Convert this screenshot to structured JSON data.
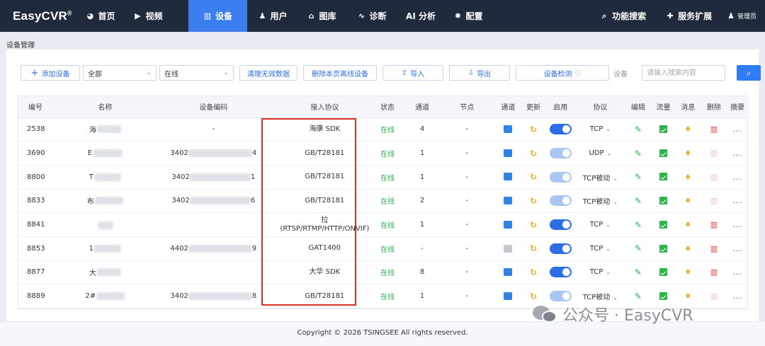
{
  "brand": {
    "name": "EasyCVR",
    "mark": "®"
  },
  "nav": {
    "items": [
      {
        "label": "首页",
        "icon": "dashboard-icon"
      },
      {
        "label": "视频",
        "icon": "play-icon"
      },
      {
        "label": "设备",
        "icon": "device-icon",
        "active": true
      },
      {
        "label": "用户",
        "icon": "user-icon"
      },
      {
        "label": "图库",
        "icon": "gallery-icon"
      },
      {
        "label": "诊断",
        "icon": "pulse-icon"
      },
      {
        "label": "AI 分析",
        "icon": ""
      },
      {
        "label": "配置",
        "icon": "gear-icon"
      }
    ],
    "right": [
      {
        "label": "功能搜索",
        "icon": "search-icon"
      },
      {
        "label": "服务扩展",
        "icon": "puzzle-icon"
      }
    ],
    "user": "管理员"
  },
  "page": {
    "title": "设备管理"
  },
  "toolbar": {
    "add_label": "添加设备",
    "filter_all": "全部",
    "filter_status": "在线",
    "clean_label": "清理无效数据",
    "delete_offline_label": "删除本页离线设备",
    "import_label": "导入",
    "export_label": "导出",
    "check_label": "设备检测",
    "search_label": "设备",
    "search_placeholder": "请输入搜索内容"
  },
  "table": {
    "headers": [
      "编号",
      "名称",
      "设备编码",
      "接入协议",
      "状态",
      "通道",
      "节点",
      "通道",
      "更新",
      "启用",
      "协议",
      "编辑",
      "流量",
      "消息",
      "删除",
      "摘要"
    ],
    "rows": [
      {
        "id": "2538",
        "name_prefix": "海",
        "code_prefix": "-",
        "code_suffix": "",
        "protocol": "海康 SDK",
        "status": "在线",
        "channels": "4",
        "node": "-",
        "enabled": true,
        "stream": "TCP",
        "folder_grey": false,
        "trash_light": false
      },
      {
        "id": "3690",
        "name_prefix": "E",
        "code_prefix": "3402",
        "code_suffix": "4",
        "protocol": "GB/T28181",
        "status": "在线",
        "channels": "1",
        "node": "-",
        "enabled": false,
        "stream": "UDP",
        "folder_grey": false,
        "trash_light": true
      },
      {
        "id": "8800",
        "name_prefix": "T",
        "code_prefix": "3402",
        "code_suffix": "1",
        "protocol": "GB/T28181",
        "status": "在线",
        "channels": "1",
        "node": "-",
        "enabled": false,
        "stream": "TCP被动",
        "folder_grey": false,
        "trash_light": true
      },
      {
        "id": "8833",
        "name_prefix": "布",
        "code_prefix": "3402",
        "code_suffix": "6",
        "protocol": "GB/T28181",
        "status": "在线",
        "channels": "2",
        "node": "-",
        "enabled": false,
        "stream": "TCP被动",
        "folder_grey": false,
        "trash_light": true
      },
      {
        "id": "8841",
        "name_prefix": "",
        "code_prefix": "",
        "code_suffix": "",
        "protocol": "拉 (RTSP/RTMP/HTTP/ONVIF)",
        "status": "在线",
        "channels": "1",
        "node": "-",
        "enabled": true,
        "stream": "TCP",
        "folder_grey": false,
        "trash_light": false
      },
      {
        "id": "8853",
        "name_prefix": "1",
        "code_prefix": "4402",
        "code_suffix": "9",
        "protocol": "GAT1400",
        "status": "在线",
        "channels": "-",
        "node": "-",
        "enabled": true,
        "stream": "TCP",
        "folder_grey": true,
        "trash_light": false
      },
      {
        "id": "8877",
        "name_prefix": "大",
        "code_prefix": "",
        "code_suffix": "",
        "protocol": "大华 SDK",
        "status": "在线",
        "channels": "8",
        "node": "-",
        "enabled": true,
        "stream": "TCP",
        "folder_grey": false,
        "trash_light": false
      },
      {
        "id": "8889",
        "name_prefix": "2#",
        "code_prefix": "3402",
        "code_suffix": "8",
        "protocol": "GB/T28181",
        "status": "在线",
        "channels": "1",
        "node": "-",
        "enabled": false,
        "stream": "TCP被动",
        "folder_grey": false,
        "trash_light": true
      }
    ],
    "summary_text": "..."
  },
  "footer": {
    "copyright": "Copyright © 2026 TSINGSEE All rights reserved."
  },
  "watermark": {
    "text": "公众号 · EasyCVR"
  },
  "colors": {
    "nav_bg": "#1f2a3d",
    "accent": "#3c7ef0",
    "online": "#2eb44a",
    "danger": "#e53935",
    "warning": "#f5a623",
    "highlight": "#d93025"
  }
}
